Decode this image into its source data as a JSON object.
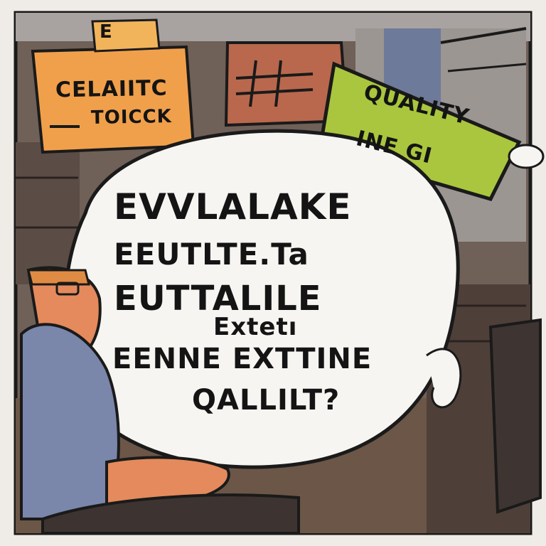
{
  "signs": {
    "top_label": "E",
    "orange_line1": "CELAIITC",
    "orange_line2": "TOICCK",
    "red_sign_marks": "##",
    "green_line1": "QUALITY",
    "green_line2": "INE GI"
  },
  "speech_bubble": {
    "line1": "EVVLALAKE",
    "line2": "EEUTLTE.Ta",
    "line3": "EUTTALILE",
    "line4": "Extetı",
    "line5": "EENNE EXTTINE",
    "line6": "QALLILT?"
  },
  "colors": {
    "orange_sign": "#f0a04b",
    "green_sign": "#a9c63e",
    "red_sign": "#b9684d",
    "bubble": "#f7f5f2",
    "shirt": "#7a86aa",
    "skin": "#e48a5c",
    "office_wall": "#5a4b43"
  },
  "icons": [
    "person-figure-icon",
    "speech-bubble-icon"
  ]
}
